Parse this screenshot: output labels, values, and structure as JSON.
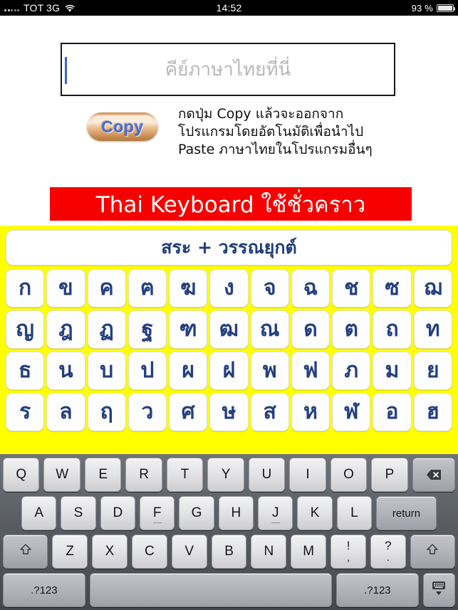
{
  "statusbar": {
    "carrier": "TOT 3G",
    "time": "14:52",
    "battery_percent": "93 %",
    "signal_icon": "signal-dots-icon",
    "wifi_icon": "wifi-icon",
    "battery_icon": "battery-icon"
  },
  "textfield": {
    "placeholder": "คีย์ภาษาไทยที่นี่",
    "value": ""
  },
  "copy": {
    "button_label": "Copy",
    "description_line1": "กดปุ่ม Copy แล้วจะออกจาก",
    "description_line2": "โปรแกรมโดยอัตโนมัติเพื่อนำไป",
    "description_line3": "Paste ภาษาไทยในโปรแกรมอื่นๆ"
  },
  "banner": {
    "text": "Thai Keyboard ใช้ชั่วคราว",
    "background_color": "#f60000",
    "text_color": "#ffffff"
  },
  "thai_keyboard": {
    "panel_color": "#ffff00",
    "key_text_color": "#24407f",
    "title_button": "สระ + วรรณยุกต์",
    "rows": [
      [
        "ก",
        "ข",
        "ค",
        "ฅ",
        "ฆ",
        "ง",
        "จ",
        "ฉ",
        "ช",
        "ซ",
        "ฌ"
      ],
      [
        "ญ",
        "ฎ",
        "ฏ",
        "ฐ",
        "ฑ",
        "ฒ",
        "ณ",
        "ด",
        "ต",
        "ถ",
        "ท"
      ],
      [
        "ธ",
        "น",
        "บ",
        "ป",
        "ผ",
        "ฝ",
        "พ",
        "ฟ",
        "ภ",
        "ม",
        "ย"
      ],
      [
        "ร",
        "ล",
        "ฤ",
        "ว",
        "ศ",
        "ษ",
        "ส",
        "ห",
        "ฬ",
        "อ",
        "ฮ"
      ]
    ]
  },
  "ios_keyboard": {
    "row1": [
      "Q",
      "W",
      "E",
      "R",
      "T",
      "Y",
      "U",
      "I",
      "O",
      "P"
    ],
    "backspace_icon": "backspace-icon",
    "row2": [
      "A",
      "S",
      "D",
      "F",
      "G",
      "H",
      "J",
      "K",
      "L"
    ],
    "return_label": "return",
    "row3": [
      "Z",
      "X",
      "C",
      "V",
      "B",
      "N",
      "M"
    ],
    "shift_icon": "shift-up-arrow-icon",
    "punct1_top": "!",
    "punct1_bottom": ",",
    "punct2_top": "?",
    "punct2_bottom": ".",
    "numeric_left": ".?123",
    "numeric_right": ".?123",
    "space_label": "",
    "hide_keyboard_icon": "hide-keyboard-icon"
  }
}
